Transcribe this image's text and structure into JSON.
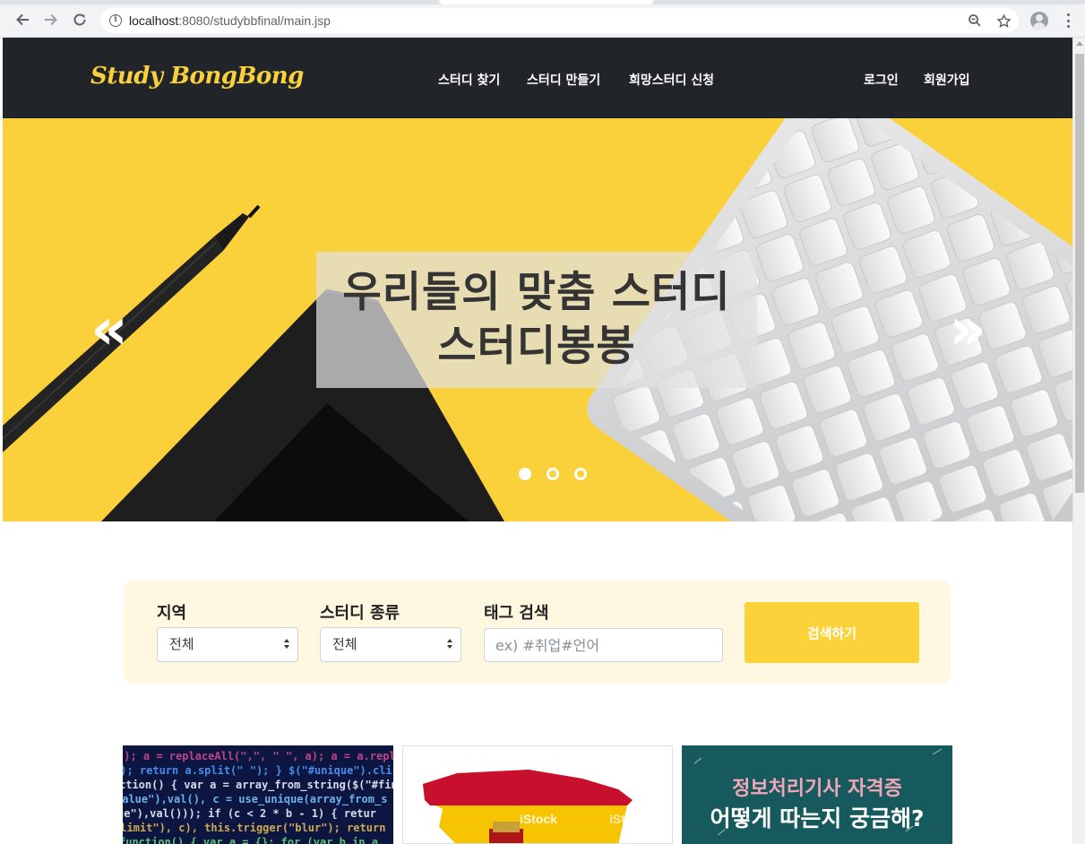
{
  "browser": {
    "url_host": "localhost",
    "url_port": ":8080",
    "url_path": "/studybbfinal/main.jsp"
  },
  "header": {
    "brand": "Study BongBong",
    "nav": [
      "스터디 찾기",
      "스터디 만들기",
      "희망스터디 신청"
    ],
    "auth": [
      "로그인",
      "회원가입"
    ]
  },
  "hero": {
    "caption_line1": "우리들의 맞춤 스터디",
    "caption_line2": "스터디봉봉",
    "prev_icon": "«",
    "next_icon": "»",
    "active_slide": 1,
    "slide_count": 3
  },
  "search": {
    "region_label": "지역",
    "region_value": "전체",
    "type_label": "스터디 종류",
    "type_value": "전체",
    "tag_label": "태그 검색",
    "tag_placeholder": "ex) #취업#언어",
    "button": "검색하기"
  },
  "cards": {
    "card2_watermark": "iStock",
    "card3_line1": "정보처리기사 자격증",
    "card3_line2": "어떻게 따는지 궁금해?"
  },
  "colors": {
    "accent": "#fbd13b",
    "header_bg": "#212529",
    "panel_bg": "#fff8e1"
  }
}
